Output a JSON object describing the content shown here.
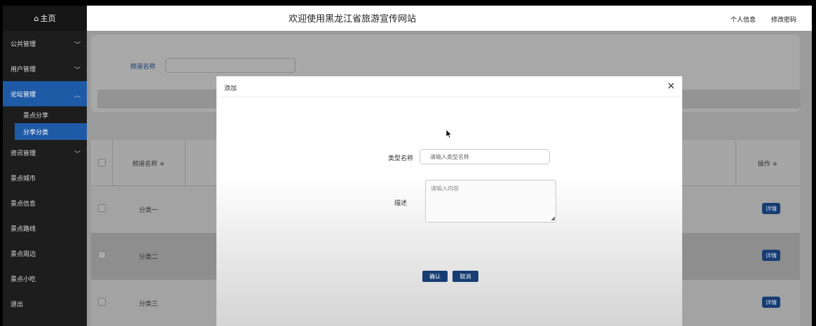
{
  "sidebar": {
    "home": "主页",
    "items": [
      {
        "label": "公共管理"
      },
      {
        "label": "用户管理"
      },
      {
        "label": "论坛管理"
      },
      {
        "label": "资讯管理"
      },
      {
        "label": "景点城市"
      },
      {
        "label": "景点信息"
      },
      {
        "label": "景点路线"
      },
      {
        "label": "景点周边"
      },
      {
        "label": "景点小吃"
      },
      {
        "label": "退出"
      }
    ],
    "subitems": [
      {
        "label": "景点分享"
      },
      {
        "label": "分享分类"
      }
    ]
  },
  "header": {
    "title": "欢迎使用黑龙江省旅游宣传网站",
    "profile": "个人信息",
    "change_password": "修改密码"
  },
  "search": {
    "label": "频道名称",
    "value": ""
  },
  "table": {
    "col_name": "频道名称",
    "col_op": "操作",
    "sort_glyph": "≑",
    "rows": [
      {
        "name": "分类一",
        "action": "详情"
      },
      {
        "name": "分类二",
        "action": "详情"
      },
      {
        "name": "分类三",
        "action": "详情"
      }
    ]
  },
  "modal": {
    "title": "添加",
    "close": "×",
    "type_label": "类型名称",
    "type_placeholder": "请输入类型名称",
    "desc_label": "描述",
    "desc_placeholder": "请输入内容",
    "confirm": "确认",
    "cancel": "取消"
  },
  "colors": {
    "sidebar_bg": "#1d1d1d",
    "accent": "#1f5aa6",
    "button": "#163d73"
  }
}
